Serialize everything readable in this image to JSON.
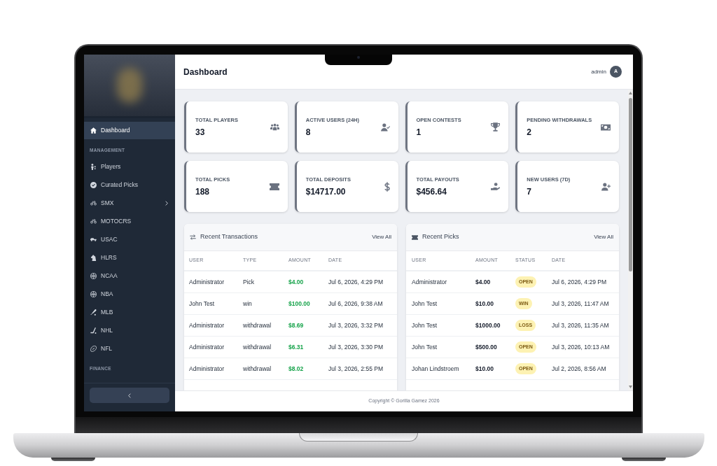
{
  "sidebar": {
    "items": [
      {
        "kind": "link",
        "label": "Dashboard",
        "selected": true
      },
      {
        "kind": "heading",
        "label": "MANAGEMENT"
      },
      {
        "kind": "link",
        "label": "Players",
        "selected": false
      },
      {
        "kind": "link",
        "label": "Curated Picks",
        "selected": false
      },
      {
        "kind": "group",
        "label": "SMX",
        "selected": false,
        "expanded": false
      },
      {
        "kind": "link",
        "label": "MOTOCRS",
        "selected": false
      },
      {
        "kind": "link",
        "label": "USAC",
        "selected": false
      },
      {
        "kind": "link",
        "label": "HLRS",
        "selected": false
      },
      {
        "kind": "link",
        "label": "NCAA",
        "selected": false
      },
      {
        "kind": "link",
        "label": "NBA",
        "selected": false
      },
      {
        "kind": "link",
        "label": "MLB",
        "selected": false
      },
      {
        "kind": "link",
        "label": "NHL",
        "selected": false
      },
      {
        "kind": "link",
        "label": "NFL",
        "selected": false
      },
      {
        "kind": "heading",
        "label": "FINANCE"
      }
    ]
  },
  "header": {
    "title": "Dashboard",
    "user": "admin",
    "avatar": "A"
  },
  "stats": [
    {
      "label": "TOTAL PLAYERS",
      "value": "33"
    },
    {
      "label": "ACTIVE USERS (24H)",
      "value": "8"
    },
    {
      "label": "OPEN CONTESTS",
      "value": "1"
    },
    {
      "label": "PENDING WITHDRAWALS",
      "value": "2"
    },
    {
      "label": "TOTAL PICKS",
      "value": "188"
    },
    {
      "label": "TOTAL DEPOSITS",
      "value": "$14717.00"
    },
    {
      "label": "TOTAL PAYOUTS",
      "value": "$456.64"
    },
    {
      "label": "NEW USERS (7D)",
      "value": "7"
    }
  ],
  "recent_transactions": {
    "title": "Recent Transactions",
    "link": "View All",
    "columns": [
      "USER",
      "TYPE",
      "AMOUNT",
      "DATE"
    ],
    "rows": [
      {
        "user": "Administrator",
        "type": "Pick",
        "amount": "$4.00",
        "date": "Jul 6, 2026, 4:29 PM"
      },
      {
        "user": "John Test",
        "type": "win",
        "amount": "$100.00",
        "date": "Jul 6, 2026, 9:38 AM"
      },
      {
        "user": "Administrator",
        "type": "withdrawal",
        "amount": "$8.69",
        "date": "Jul 3, 2026, 3:32 PM"
      },
      {
        "user": "Administrator",
        "type": "withdrawal",
        "amount": "$6.31",
        "date": "Jul 3, 2026, 3:30 PM"
      },
      {
        "user": "Administrator",
        "type": "withdrawal",
        "amount": "$8.02",
        "date": "Jul 3, 2026, 2:55 PM"
      }
    ]
  },
  "recent_picks": {
    "title": "Recent Picks",
    "link": "View All",
    "columns": [
      "USER",
      "AMOUNT",
      "STATUS",
      "DATE"
    ],
    "rows": [
      {
        "user": "Administrator",
        "amount": "$4.00",
        "status": "OPEN",
        "date": "Jul 6, 2026, 4:29 PM"
      },
      {
        "user": "John Test",
        "amount": "$10.00",
        "status": "WIN",
        "date": "Jul 3, 2026, 11:47 AM"
      },
      {
        "user": "John Test",
        "amount": "$1000.00",
        "status": "LOSS",
        "date": "Jul 3, 2026, 11:35 AM"
      },
      {
        "user": "John Test",
        "amount": "$500.00",
        "status": "OPEN",
        "date": "Jul 3, 2026, 10:13 AM"
      },
      {
        "user": "Johan Lindstroem",
        "amount": "$10.00",
        "status": "OPEN",
        "date": "Jul 2, 2026, 8:56 AM"
      }
    ]
  },
  "footer": {
    "copyright": "Copyright © Gorilla Gamez 2026"
  }
}
